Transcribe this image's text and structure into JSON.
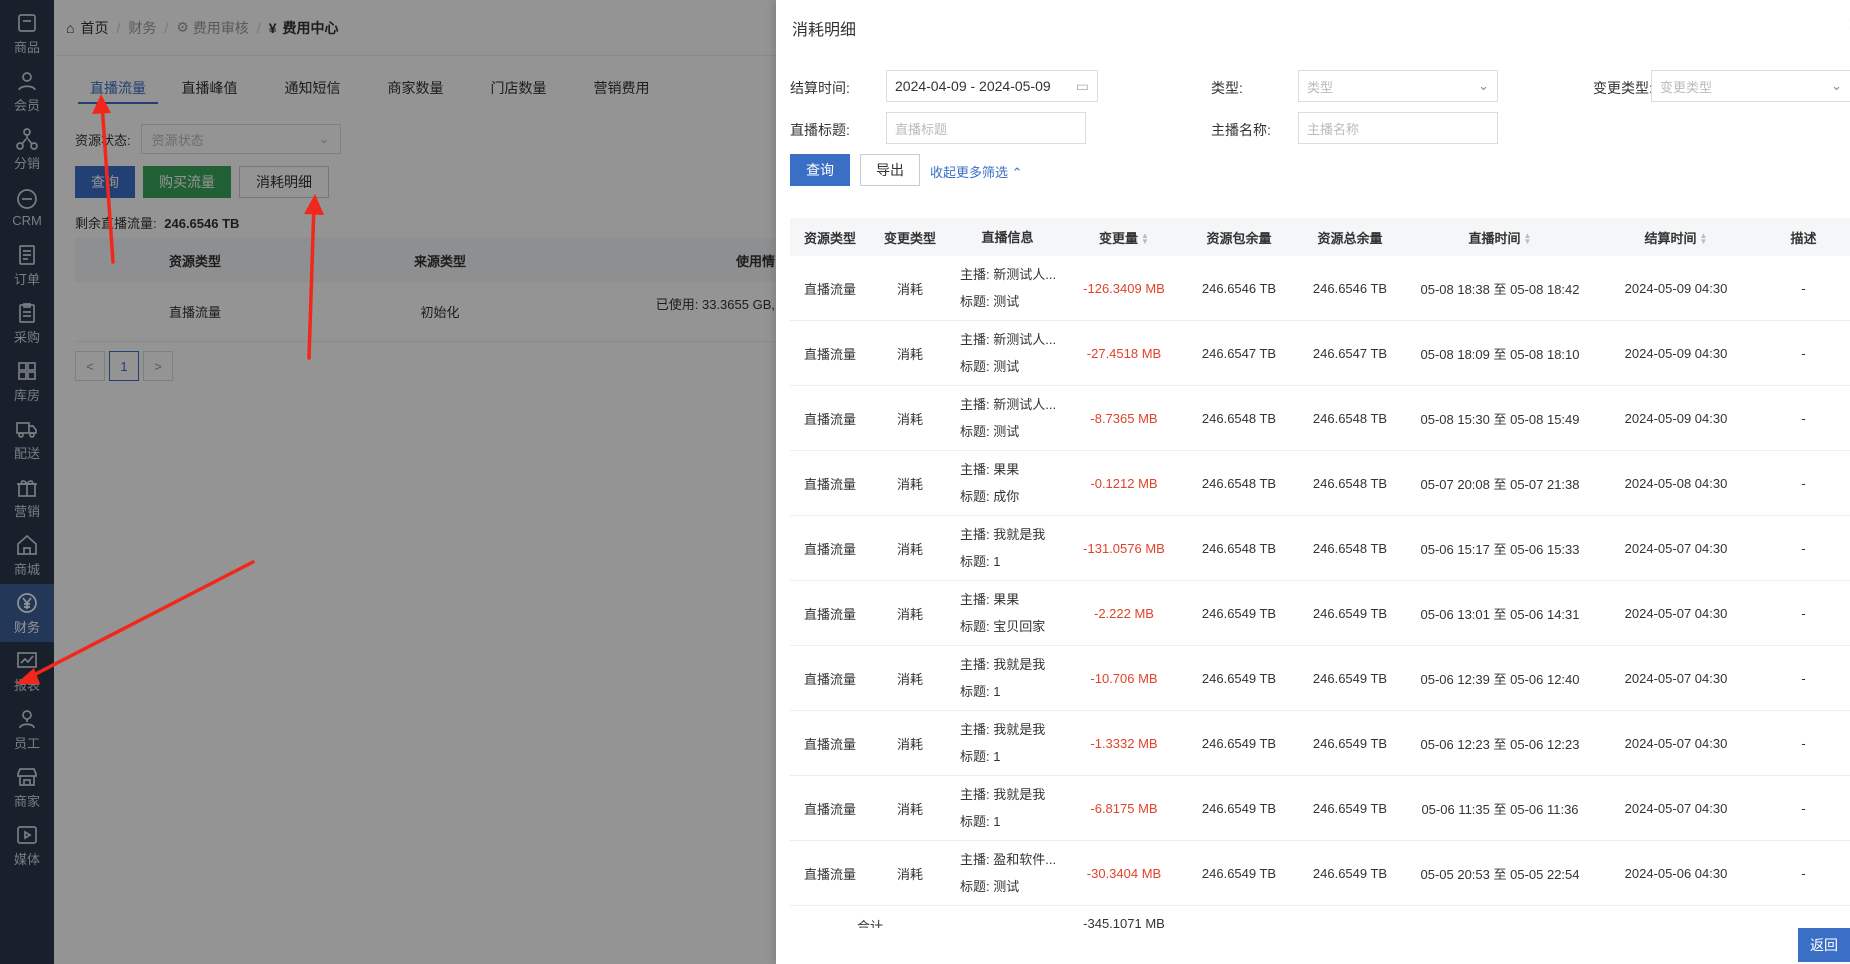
{
  "sidebar": {
    "items": [
      {
        "label": "商品",
        "icon": "box-icon"
      },
      {
        "label": "会员",
        "icon": "user-icon"
      },
      {
        "label": "分销",
        "icon": "network-icon"
      },
      {
        "label": "CRM",
        "icon": "crm-icon"
      },
      {
        "label": "订单",
        "icon": "document-icon"
      },
      {
        "label": "采购",
        "icon": "clipboard-icon"
      },
      {
        "label": "库房",
        "icon": "grid-icon"
      },
      {
        "label": "配送",
        "icon": "truck-icon"
      },
      {
        "label": "营销",
        "icon": "gift-icon"
      },
      {
        "label": "商城",
        "icon": "home-icon"
      },
      {
        "label": "财务",
        "icon": "yen-icon"
      },
      {
        "label": "报表",
        "icon": "chart-icon"
      },
      {
        "label": "员工",
        "icon": "staff-icon"
      },
      {
        "label": "商家",
        "icon": "store-icon"
      },
      {
        "label": "媒体",
        "icon": "play-icon"
      }
    ],
    "active_index": 10
  },
  "breadcrumb": {
    "home": "首页",
    "finance": "财务",
    "audit": "费用审核",
    "current": "费用中心",
    "current_icon": "¥"
  },
  "main_tabs": [
    "直播流量",
    "直播峰值",
    "通知短信",
    "商家数量",
    "门店数量",
    "营销费用"
  ],
  "filter": {
    "label": "资源状态:",
    "placeholder": "资源状态"
  },
  "buttons": {
    "query": "查询",
    "buy": "购买流量",
    "detail": "消耗明细"
  },
  "remaining": {
    "label": "剩余直播流量:",
    "value": "246.6546 TB"
  },
  "left_table": {
    "headers": [
      "资源类型",
      "来源类型",
      "使用情"
    ],
    "row": {
      "type": "直播流量",
      "source": "初始化",
      "usage": "已使用: 33.3655 GB,"
    }
  },
  "pager": {
    "prev": "<",
    "page": "1",
    "next": ">"
  },
  "drawer": {
    "title": "消耗明细",
    "close": "×",
    "filters": {
      "settle_label": "结算时间:",
      "settle_value": "2024-04-09 - 2024-05-09",
      "type_label": "类型:",
      "type_placeholder": "类型",
      "change_label": "变更类型:",
      "change_placeholder": "变更类型",
      "title_label": "直播标题:",
      "title_placeholder": "直播标题",
      "anchor_label": "主播名称:",
      "anchor_placeholder": "主播名称"
    },
    "query": "查询",
    "export": "导出",
    "collapse": "收起更多筛选",
    "headers": [
      "资源类型",
      "变更类型",
      "直播信息",
      "变更量",
      "资源包余量",
      "资源总余量",
      "直播时间",
      "结算时间",
      "描述"
    ],
    "rows": [
      {
        "rt": "直播流量",
        "ct": "消耗",
        "anchor": "主播: 新测试人...",
        "title": "标题: 测试",
        "cv": "-126.3409 MB",
        "pr": "246.6546 TB",
        "tr": "246.6546 TB",
        "lt": "05-08 18:38 至 05-08 18:42",
        "st": "2024-05-09 04:30",
        "ds": "-"
      },
      {
        "rt": "直播流量",
        "ct": "消耗",
        "anchor": "主播: 新测试人...",
        "title": "标题: 测试",
        "cv": "-27.4518 MB",
        "pr": "246.6547 TB",
        "tr": "246.6547 TB",
        "lt": "05-08 18:09 至 05-08 18:10",
        "st": "2024-05-09 04:30",
        "ds": "-"
      },
      {
        "rt": "直播流量",
        "ct": "消耗",
        "anchor": "主播: 新测试人...",
        "title": "标题: 测试",
        "cv": "-8.7365 MB",
        "pr": "246.6548 TB",
        "tr": "246.6548 TB",
        "lt": "05-08 15:30 至 05-08 15:49",
        "st": "2024-05-09 04:30",
        "ds": "-"
      },
      {
        "rt": "直播流量",
        "ct": "消耗",
        "anchor": "主播: 果果",
        "title": "标题: 成你",
        "cv": "-0.1212 MB",
        "pr": "246.6548 TB",
        "tr": "246.6548 TB",
        "lt": "05-07 20:08 至 05-07 21:38",
        "st": "2024-05-08 04:30",
        "ds": "-"
      },
      {
        "rt": "直播流量",
        "ct": "消耗",
        "anchor": "主播: 我就是我",
        "title": "标题: 1",
        "cv": "-131.0576 MB",
        "pr": "246.6548 TB",
        "tr": "246.6548 TB",
        "lt": "05-06 15:17 至 05-06 15:33",
        "st": "2024-05-07 04:30",
        "ds": "-"
      },
      {
        "rt": "直播流量",
        "ct": "消耗",
        "anchor": "主播: 果果",
        "title": "标题: 宝贝回家",
        "cv": "-2.222 MB",
        "pr": "246.6549 TB",
        "tr": "246.6549 TB",
        "lt": "05-06 13:01 至 05-06 14:31",
        "st": "2024-05-07 04:30",
        "ds": "-"
      },
      {
        "rt": "直播流量",
        "ct": "消耗",
        "anchor": "主播: 我就是我",
        "title": "标题: 1",
        "cv": "-10.706 MB",
        "pr": "246.6549 TB",
        "tr": "246.6549 TB",
        "lt": "05-06 12:39 至 05-06 12:40",
        "st": "2024-05-07 04:30",
        "ds": "-"
      },
      {
        "rt": "直播流量",
        "ct": "消耗",
        "anchor": "主播: 我就是我",
        "title": "标题: 1",
        "cv": "-1.3332 MB",
        "pr": "246.6549 TB",
        "tr": "246.6549 TB",
        "lt": "05-06 12:23 至 05-06 12:23",
        "st": "2024-05-07 04:30",
        "ds": "-"
      },
      {
        "rt": "直播流量",
        "ct": "消耗",
        "anchor": "主播: 我就是我",
        "title": "标题: 1",
        "cv": "-6.8175 MB",
        "pr": "246.6549 TB",
        "tr": "246.6549 TB",
        "lt": "05-06 11:35 至 05-06 11:36",
        "st": "2024-05-07 04:30",
        "ds": "-"
      },
      {
        "rt": "直播流量",
        "ct": "消耗",
        "anchor": "主播: 盈和软件...",
        "title": "标题: 测试",
        "cv": "-30.3404 MB",
        "pr": "246.6549 TB",
        "tr": "246.6549 TB",
        "lt": "05-05 20:53 至 05-05 22:54",
        "st": "2024-05-06 04:30",
        "ds": "-"
      }
    ],
    "footer": {
      "label": "合计",
      "value": "-345.1071 MB"
    },
    "return": "返回"
  },
  "colors": {
    "sidebar": "#2a3a4a",
    "accent": "#3b6fc6",
    "negative": "#e0432a",
    "annotation_arrow": "#f2271b"
  }
}
